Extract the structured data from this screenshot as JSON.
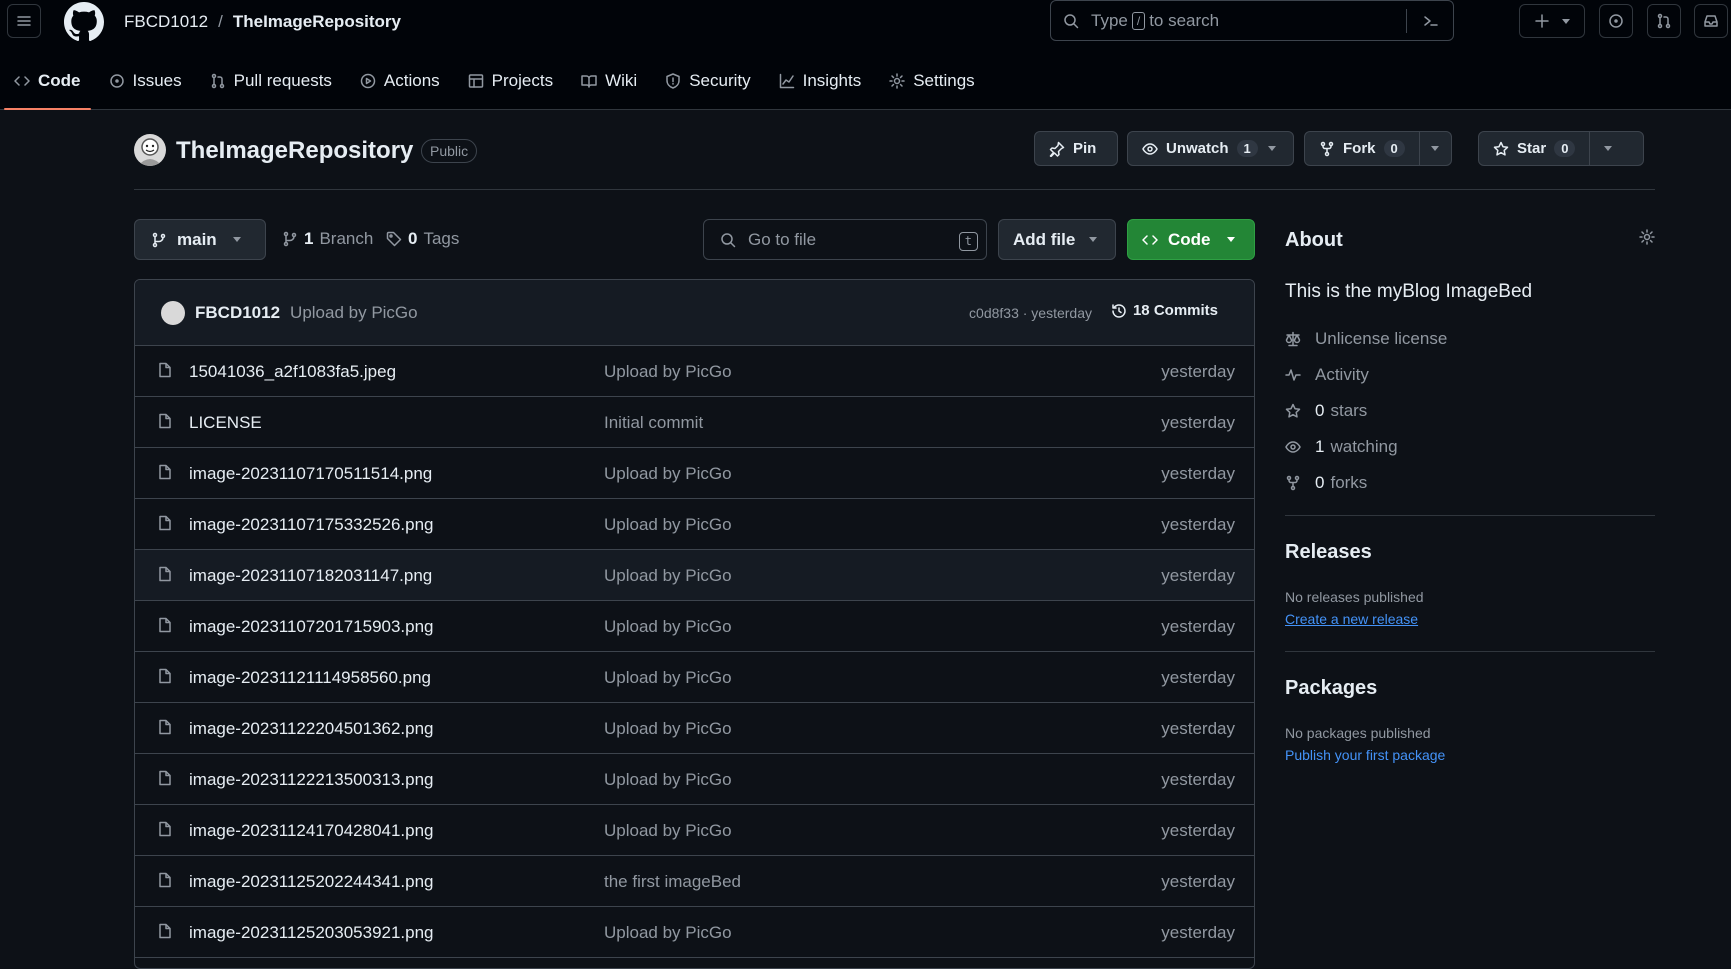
{
  "header": {
    "owner": "FBCD1012",
    "separator": "/",
    "repo": "TheImageRepository",
    "search_prefix": "Type",
    "search_key": "/",
    "search_suffix": "to search"
  },
  "tabs": [
    {
      "label": "Code",
      "icon": "code-icon"
    },
    {
      "label": "Issues",
      "icon": "issue-icon"
    },
    {
      "label": "Pull requests",
      "icon": "pull-request-icon"
    },
    {
      "label": "Actions",
      "icon": "play-icon"
    },
    {
      "label": "Projects",
      "icon": "table-icon"
    },
    {
      "label": "Wiki",
      "icon": "book-icon"
    },
    {
      "label": "Security",
      "icon": "shield-icon"
    },
    {
      "label": "Insights",
      "icon": "graph-icon"
    },
    {
      "label": "Settings",
      "icon": "gear-icon"
    }
  ],
  "repo": {
    "title": "TheImageRepository",
    "visibility": "Public",
    "pin_label": "Pin",
    "unwatch_label": "Unwatch",
    "unwatch_count": "1",
    "fork_label": "Fork",
    "fork_count": "0",
    "star_label": "Star",
    "star_count": "0"
  },
  "filebar": {
    "branch": "main",
    "branches_count": "1",
    "branches_label": "Branch",
    "tags_count": "0",
    "tags_label": "Tags",
    "goto_placeholder": "Go to file",
    "goto_key": "t",
    "add_file": "Add file",
    "code": "Code"
  },
  "commit": {
    "author": "FBCD1012",
    "message": "Upload by PicGo",
    "hash_time": "c0d8f33 · yesterday",
    "commits": "18 Commits"
  },
  "files": [
    {
      "name": "15041036_a2f1083fa5.jpeg",
      "message": "Upload by PicGo",
      "date": "yesterday"
    },
    {
      "name": "LICENSE",
      "message": "Initial commit",
      "date": "yesterday"
    },
    {
      "name": "image-20231107170511514.png",
      "message": "Upload by PicGo",
      "date": "yesterday"
    },
    {
      "name": "image-20231107175332526.png",
      "message": "Upload by PicGo",
      "date": "yesterday"
    },
    {
      "name": "image-20231107182031147.png",
      "message": "Upload by PicGo",
      "date": "yesterday"
    },
    {
      "name": "image-20231107201715903.png",
      "message": "Upload by PicGo",
      "date": "yesterday"
    },
    {
      "name": "image-20231121114958560.png",
      "message": "Upload by PicGo",
      "date": "yesterday"
    },
    {
      "name": "image-20231122204501362.png",
      "message": "Upload by PicGo",
      "date": "yesterday"
    },
    {
      "name": "image-20231122213500313.png",
      "message": "Upload by PicGo",
      "date": "yesterday"
    },
    {
      "name": "image-20231124170428041.png",
      "message": "Upload by PicGo",
      "date": "yesterday"
    },
    {
      "name": "image-20231125202244341.png",
      "message": "the first imageBed",
      "date": "yesterday"
    },
    {
      "name": "image-20231125203053921.png",
      "message": "Upload by PicGo",
      "date": "yesterday"
    }
  ],
  "about": {
    "heading": "About",
    "description": "This is the myBlog ImageBed",
    "license": "Unlicense license",
    "activity": "Activity",
    "stars_count": "0",
    "stars_label": "stars",
    "watching_count": "1",
    "watching_label": "watching",
    "forks_count": "0",
    "forks_label": "forks"
  },
  "releases": {
    "heading": "Releases",
    "none": "No releases published",
    "link": "Create a new release"
  },
  "packages": {
    "heading": "Packages",
    "none": "No packages published",
    "link": "Publish your first package"
  }
}
